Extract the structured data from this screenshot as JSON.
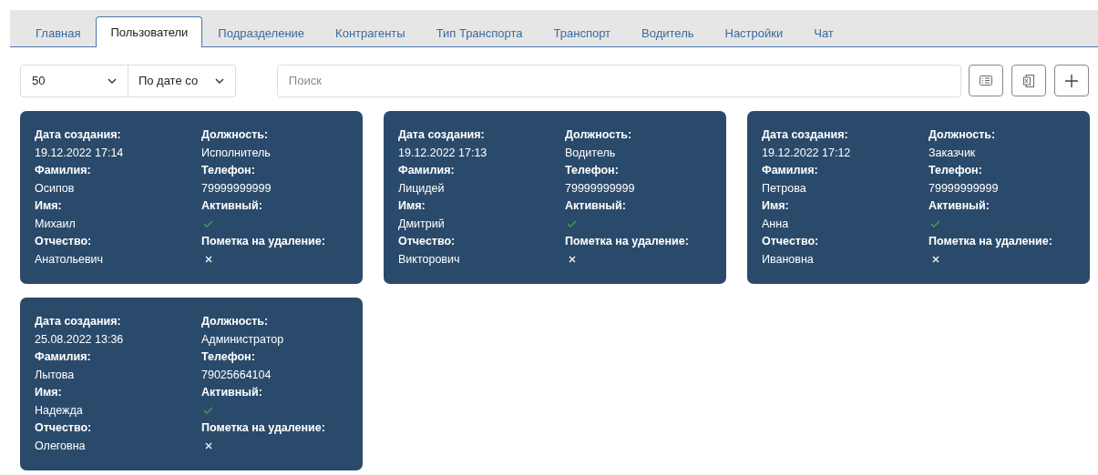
{
  "tabs": [
    {
      "label": "Главная",
      "selected": false
    },
    {
      "label": "Пользователи",
      "selected": true
    },
    {
      "label": "Подразделение",
      "selected": false
    },
    {
      "label": "Контрагенты",
      "selected": false
    },
    {
      "label": "Тип Транспорта",
      "selected": false
    },
    {
      "label": "Транспорт",
      "selected": false
    },
    {
      "label": "Водитель",
      "selected": false
    },
    {
      "label": "Настройки",
      "selected": false
    },
    {
      "label": "Чат",
      "selected": false
    }
  ],
  "toolbar": {
    "page_size": "50",
    "sort": "По дате со",
    "search": {
      "placeholder": "Поиск"
    }
  },
  "cards": [
    {
      "left": [
        {
          "label": "Дата создания:",
          "value": "19.12.2022 17:14"
        },
        {
          "label": "Фамилия:",
          "value": "Осипов"
        },
        {
          "label": "Имя:",
          "value": "Михаил"
        },
        {
          "label": "Отчество:",
          "value": "Анатольевич"
        }
      ],
      "right": [
        {
          "label": "Должность:",
          "value": "Исполнитель"
        },
        {
          "label": "Телефон:",
          "value": "79999999999"
        },
        {
          "label": "Активный:",
          "kind": "flag",
          "on": true
        },
        {
          "label": "Пометка на удаление:",
          "kind": "flag",
          "on": false
        }
      ]
    },
    {
      "left": [
        {
          "label": "Дата создания:",
          "value": "19.12.2022 17:13"
        },
        {
          "label": "Фамилия:",
          "value": "Лицидей"
        },
        {
          "label": "Имя:",
          "value": "Дмитрий"
        },
        {
          "label": "Отчество:",
          "value": "Викторович"
        }
      ],
      "right": [
        {
          "label": "Должность:",
          "value": "Водитель"
        },
        {
          "label": "Телефон:",
          "value": "79999999999"
        },
        {
          "label": "Активный:",
          "kind": "flag",
          "on": true
        },
        {
          "label": "Пометка на удаление:",
          "kind": "flag",
          "on": false
        }
      ]
    },
    {
      "left": [
        {
          "label": "Дата создания:",
          "value": "19.12.2022 17:12"
        },
        {
          "label": "Фамилия:",
          "value": "Петрова"
        },
        {
          "label": "Имя:",
          "value": "Анна"
        },
        {
          "label": "Отчество:",
          "value": "Ивановна"
        }
      ],
      "right": [
        {
          "label": "Должность:",
          "value": "Заказчик"
        },
        {
          "label": "Телефон:",
          "value": "79999999999"
        },
        {
          "label": "Активный:",
          "kind": "flag",
          "on": true
        },
        {
          "label": "Пометка на удаление:",
          "kind": "flag",
          "on": false
        }
      ]
    },
    {
      "left": [
        {
          "label": "Дата создания:",
          "value": "25.08.2022 13:36"
        },
        {
          "label": "Фамилия:",
          "value": "Лытова"
        },
        {
          "label": "Имя:",
          "value": "Надежда"
        },
        {
          "label": "Отчество:",
          "value": "Олеговна"
        }
      ],
      "right": [
        {
          "label": "Должность:",
          "value": "Администратор"
        },
        {
          "label": "Телефон:",
          "value": "79025664104"
        },
        {
          "label": "Активный:",
          "kind": "flag",
          "on": true
        },
        {
          "label": "Пометка на удаление:",
          "kind": "flag",
          "on": false
        }
      ]
    }
  ]
}
